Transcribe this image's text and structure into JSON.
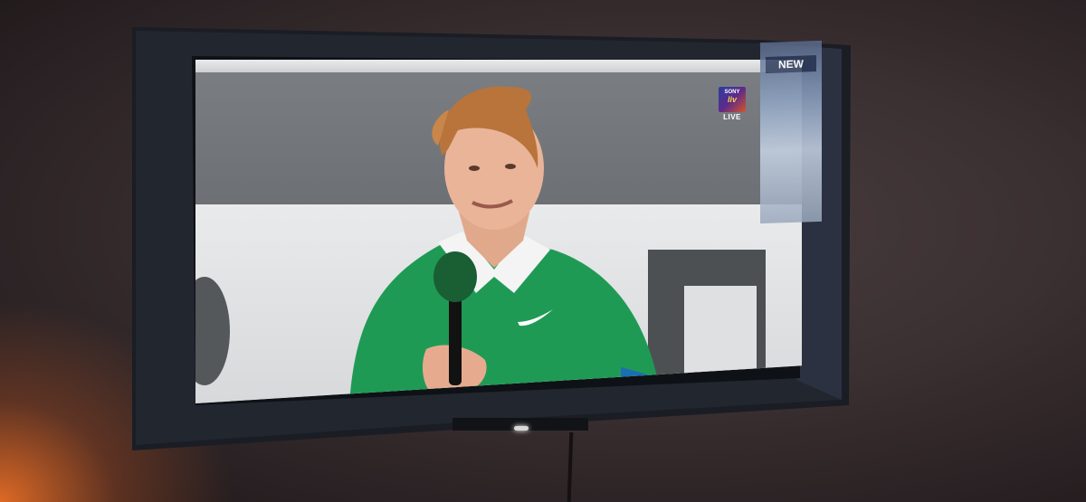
{
  "scene": {
    "description_none": "",
    "wall_color": "#3a2f31",
    "tv_frame_color": "#1a1d24",
    "screen_bg_color": "#9aa0a6",
    "shirt_color": "#1f9a55",
    "glow_color": "#ff7828"
  },
  "broadcast": {
    "logo_line1": "SONY",
    "logo_line2": "liv",
    "live_label": "LIVE"
  },
  "sticker": {
    "badge": "NEW"
  }
}
